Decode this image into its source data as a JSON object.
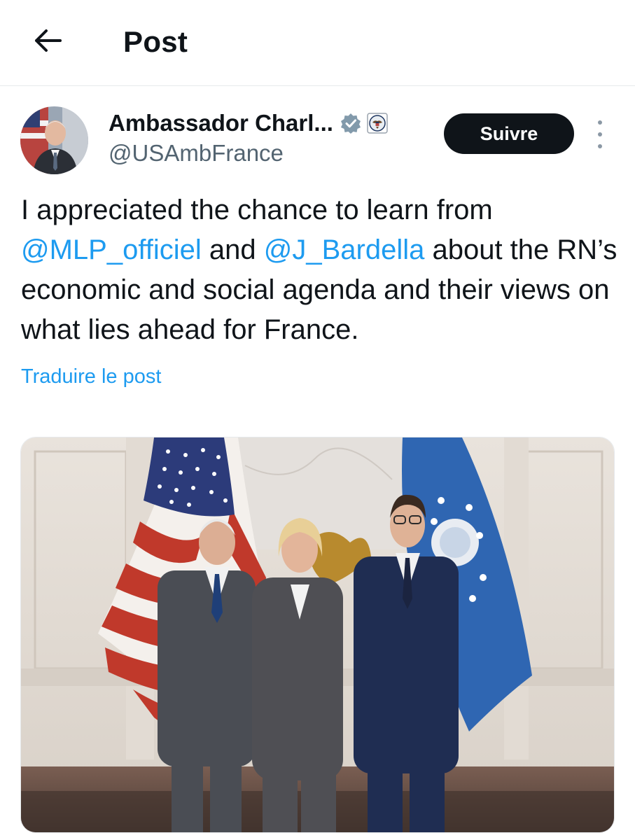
{
  "header": {
    "title": "Post",
    "back_icon": "arrow-left-icon"
  },
  "post": {
    "author": {
      "name": "Ambassador Charl...",
      "handle": "@USAmbFrance",
      "verified_icon": "verified-badge-icon",
      "affiliation_icon": "state-department-seal-icon"
    },
    "follow_label": "Suivre",
    "more_icon": "more-vertical-icon",
    "text": {
      "part1": "I appreciated the chance to learn from ",
      "mention1": "@MLP_officiel",
      "part2": " and ",
      "mention2": "@J_Bardella",
      "part3": " about the RN’s economic and social agenda and their views on what lies ahead for France."
    },
    "translate_label": "Traduire le post"
  },
  "colors": {
    "accent": "#1d9bf0",
    "text": "#0f1419",
    "secondary": "#536471",
    "button_bg": "#0f1419"
  }
}
